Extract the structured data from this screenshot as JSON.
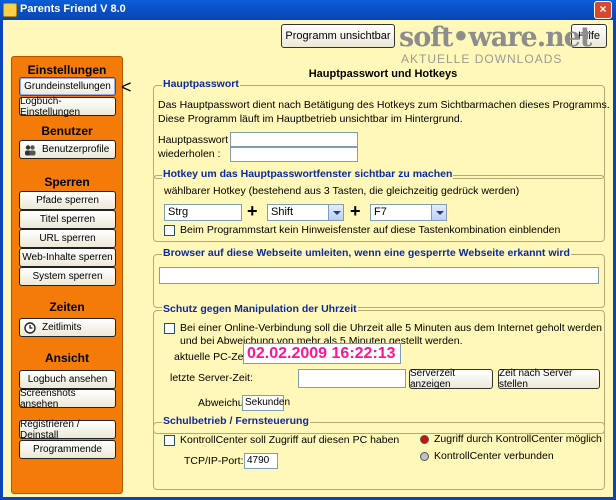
{
  "window": {
    "title": "Parents Friend V 8.0",
    "close": "×"
  },
  "header": {
    "hide_button": "Programm unsichtbar",
    "help_button": "Hilfe"
  },
  "watermark": {
    "title": "soft•ware.net",
    "subtitle": "AKTUELLE DOWNLOADS"
  },
  "sidebar": {
    "einstellungen": {
      "title": "Einstellungen",
      "items": [
        "Grundeinstellungen",
        "Logbuch-Einstellungen"
      ]
    },
    "benutzer": {
      "title": "Benutzer",
      "items": [
        "Benutzerprofile"
      ]
    },
    "sperren": {
      "title": "Sperren",
      "items": [
        "Pfade sperren",
        "Titel sperren",
        "URL sperren",
        "Web-Inhalte sperren",
        "System sperren"
      ]
    },
    "zeiten": {
      "title": "Zeiten",
      "items": [
        "Zeitlimits"
      ]
    },
    "ansicht": {
      "title": "Ansicht",
      "items": [
        "Logbuch ansehen",
        "Screenshots ansehen"
      ]
    },
    "bottom": {
      "items": [
        "Registrieren / Deinstall",
        "Programmende"
      ]
    }
  },
  "arrow": "<",
  "main": {
    "title": "Hauptpasswort und Hotkeys",
    "password": {
      "legend": "Hauptpasswort",
      "desc1": "Das Hauptpasswort dient nach Betätigung des Hotkeys zum Sichtbarmachen dieses Programms.",
      "desc2": "Diese Programm läuft im Hauptbetrieb unsichtbar im Hintergrund.",
      "label1": "Hauptpasswort :",
      "label2": "wiederholen :",
      "value1": "",
      "value2": ""
    },
    "hotkey": {
      "legend": "Hotkey um das Hauptpasswortfenster sichtbar zu machen",
      "desc": "wählbarer Hotkey (bestehend aus 3 Tasten, die gleichzeitig gedrück werden)",
      "key1": "Strg",
      "plus": "+",
      "key2": "Shift",
      "key3": "F7",
      "checkbox": "Beim Programmstart kein Hinweisfenster auf diese Tastenkombination einblenden"
    },
    "redirect": {
      "legend": "Browser auf diese Webseite umleiten, wenn eine gesperrte Webseite erkannt wird",
      "value": ""
    },
    "time": {
      "legend": "Schutz gegen Manipulation der Uhrzeit",
      "checkbox1": "Bei einer Online-Verbindung soll die Uhrzeit alle 5 Minuten aus dem Internet geholt werden",
      "checkbox2": "und bei Abweichung von mehr als 5 Minuten gestellt werden.",
      "pc_label": "aktuelle PC-Zeit:",
      "pc_value": "02.02.2009 16:22:13",
      "server_label": "letzte Server-Zeit:",
      "server_value": "",
      "show_button": "Serverzeit anzeigen",
      "set_button": "Zeit nach Server stellen",
      "dev_label": "Abweichung:",
      "dev_value": "Sekunden"
    },
    "school": {
      "legend": "Schulbetrieb / Fernsteuerung",
      "checkbox": "KontrollCenter soll Zugriff auf diesen PC haben",
      "port_label": "TCP/IP-Port:",
      "port_value": "4790",
      "status1": "Zugriff durch KontrollCenter möglich",
      "status2": "KontrollCenter verbunden",
      "status1_color": "#d01010",
      "status2_color": "#c0c0c8"
    }
  }
}
